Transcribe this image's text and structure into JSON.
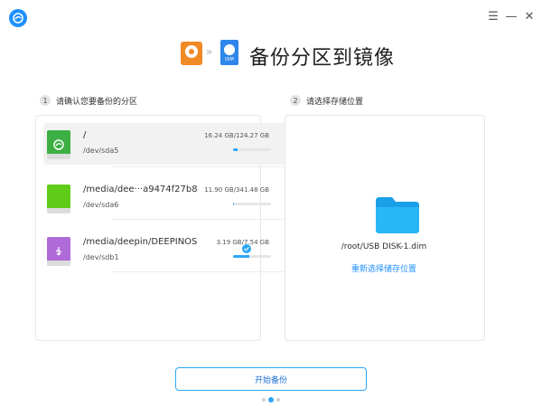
{
  "window": {
    "minimize_glyph": "—",
    "close_glyph": "✕",
    "menu_glyph": "☰"
  },
  "header": {
    "title": "备份分区到镜像",
    "arrow": "»",
    "dim_label": "DIM"
  },
  "steps": [
    {
      "num": "1",
      "label": "请确认您要备份的分区"
    },
    {
      "num": "2",
      "label": "请选择存储位置"
    }
  ],
  "partitions": [
    {
      "name": "/",
      "device": "/dev/sda5",
      "size": "16.24 GB/124.27 GB",
      "usage": 0.13,
      "color": "#3cb043",
      "mark": "deepin-icon",
      "selected": true
    },
    {
      "name": "/media/dee···a9474f27b8",
      "device": "/dev/sda6",
      "size": "11.90 GB/341.48 GB",
      "usage": 0.035,
      "color": "#5fcc1a",
      "mark": "none",
      "selected": false
    },
    {
      "name": "/media/deepin/DEEPINOS",
      "device": "/dev/sdb1",
      "size": "3.19 GB/7.54 GB",
      "usage": 0.42,
      "color": "#b06ad8",
      "mark": "usb-icon",
      "selected": false,
      "checked": true
    }
  ],
  "destination": {
    "path": "/root/USB DISK-1.dim",
    "reselect_label": "重新选择储存位置"
  },
  "start_button": "开始备份",
  "colors": {
    "accent": "#2ca7f8",
    "link": "#1e90ff"
  }
}
